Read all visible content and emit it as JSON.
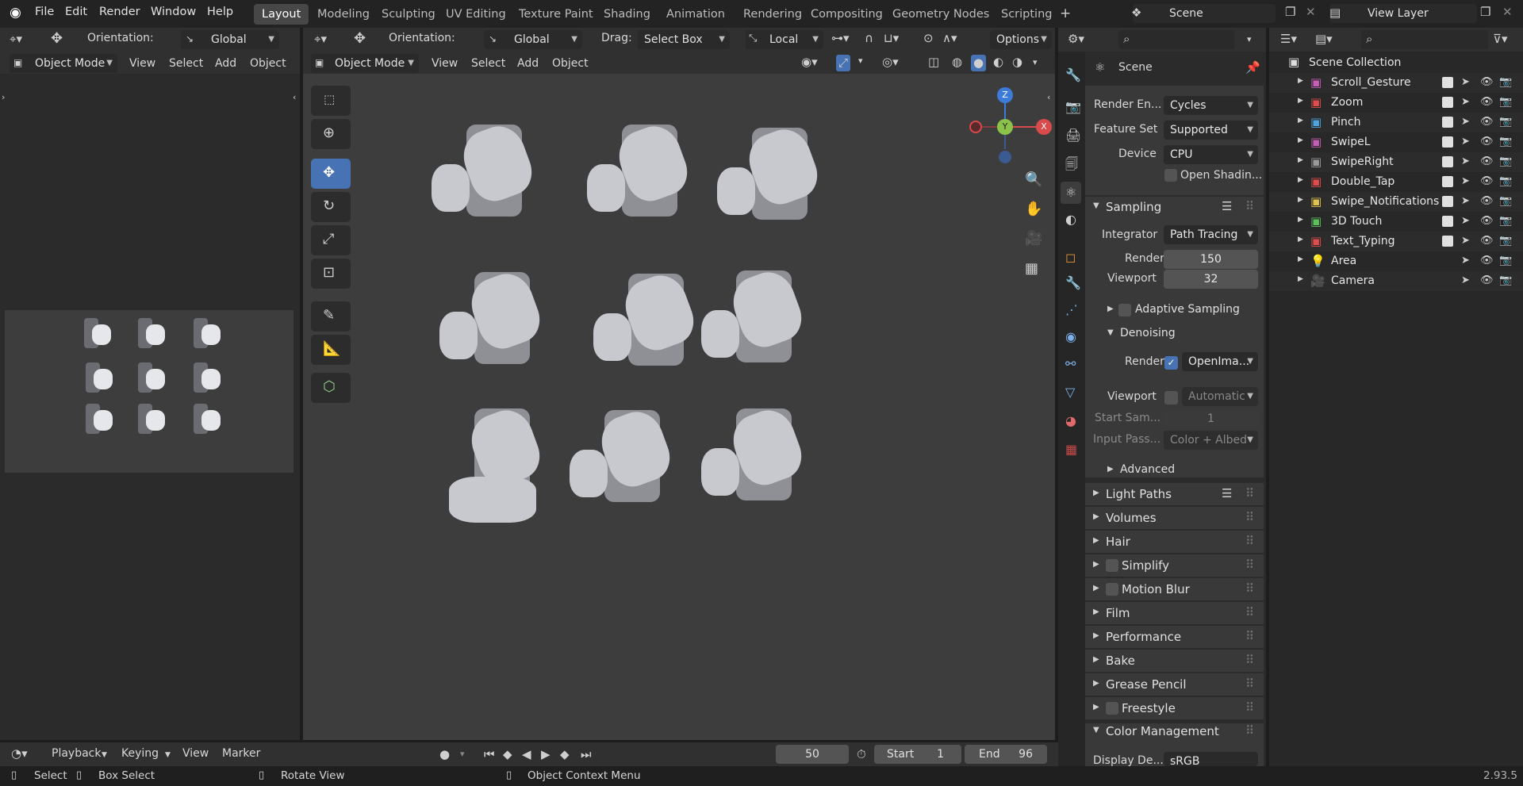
{
  "menu": {
    "file": "File",
    "edit": "Edit",
    "render": "Render",
    "window": "Window",
    "help": "Help"
  },
  "workspaces": [
    "Layout",
    "Modeling",
    "Sculpting",
    "UV Editing",
    "Texture Paint",
    "Shading",
    "Animation",
    "Rendering",
    "Compositing",
    "Geometry Nodes",
    "Scripting"
  ],
  "scene_name": "Scene",
  "view_layer": "View Layer",
  "left_header": {
    "orientation_label": "Orientation:",
    "orientation": "Global",
    "mode": "Object Mode",
    "view": "View",
    "select": "Select",
    "add": "Add",
    "object": "Object"
  },
  "viewport_header": {
    "orientation_label": "Orientation:",
    "orientation": "Global",
    "drag_label": "Drag:",
    "drag": "Select Box",
    "pivot": "Local",
    "options": "Options",
    "mode": "Object Mode",
    "view": "View",
    "select": "Select",
    "add": "Add",
    "object": "Object"
  },
  "gizmo": {
    "z": "Z",
    "y": "Y",
    "x": "X"
  },
  "properties": {
    "title": "Scene",
    "render_engine_label": "Render En...",
    "render_engine": "Cycles",
    "feature_set_label": "Feature Set",
    "feature_set": "Supported",
    "device_label": "Device",
    "device": "CPU",
    "open_shading": "Open Shadin...",
    "sampling": "Sampling",
    "integrator_label": "Integrator",
    "integrator": "Path Tracing",
    "render_label": "Render",
    "render_samples": "150",
    "viewport_label": "Viewport",
    "viewport_samples": "32",
    "adaptive": "Adaptive Sampling",
    "denoising": "Denoising",
    "den_render_label": "Render",
    "den_render_value": "OpenIma...",
    "den_viewport_label": "Viewport",
    "den_viewport_value": "Automatic",
    "start_label": "Start Sam...",
    "start_value": "1",
    "input_label": "Input Pass...",
    "input_value": "Color + Albed",
    "advanced": "Advanced",
    "light_paths": "Light Paths",
    "volumes": "Volumes",
    "hair": "Hair",
    "simplify": "Simplify",
    "motion_blur": "Motion Blur",
    "film": "Film",
    "performance": "Performance",
    "bake": "Bake",
    "grease_pencil": "Grease Pencil",
    "freestyle": "Freestyle",
    "color_management": "Color Management",
    "display_label": "Display De...",
    "display_value": "sRGB"
  },
  "outliner": {
    "root": "Scene Collection",
    "items": [
      {
        "name": "Scroll_Gesture",
        "color": "#c65db6"
      },
      {
        "name": "Zoom",
        "color": "#e04c4c"
      },
      {
        "name": "Pinch",
        "color": "#4ca4e0"
      },
      {
        "name": "SwipeL",
        "color": "#c65db6"
      },
      {
        "name": "SwipeRight",
        "color": "#9a9a9a"
      },
      {
        "name": "Double_Tap",
        "color": "#e04c4c"
      },
      {
        "name": "Swipe_Notifications",
        "color": "#e0c24c"
      },
      {
        "name": "3D Touch",
        "color": "#5bbf5b"
      },
      {
        "name": "Text_Typing",
        "color": "#e04c4c"
      },
      {
        "name": "Area",
        "color": "#e0a24c"
      },
      {
        "name": "Camera",
        "color": "#e0a24c"
      }
    ]
  },
  "timeline": {
    "playback": "Playback",
    "keying": "Keying",
    "view": "View",
    "marker": "Marker",
    "current": "50",
    "start_label": "Start",
    "start": "1",
    "end_label": "End",
    "end": "96"
  },
  "status": {
    "select": "Select",
    "box": "Box Select",
    "rotate": "Rotate View",
    "context": "Object Context Menu",
    "version": "2.93.5"
  }
}
